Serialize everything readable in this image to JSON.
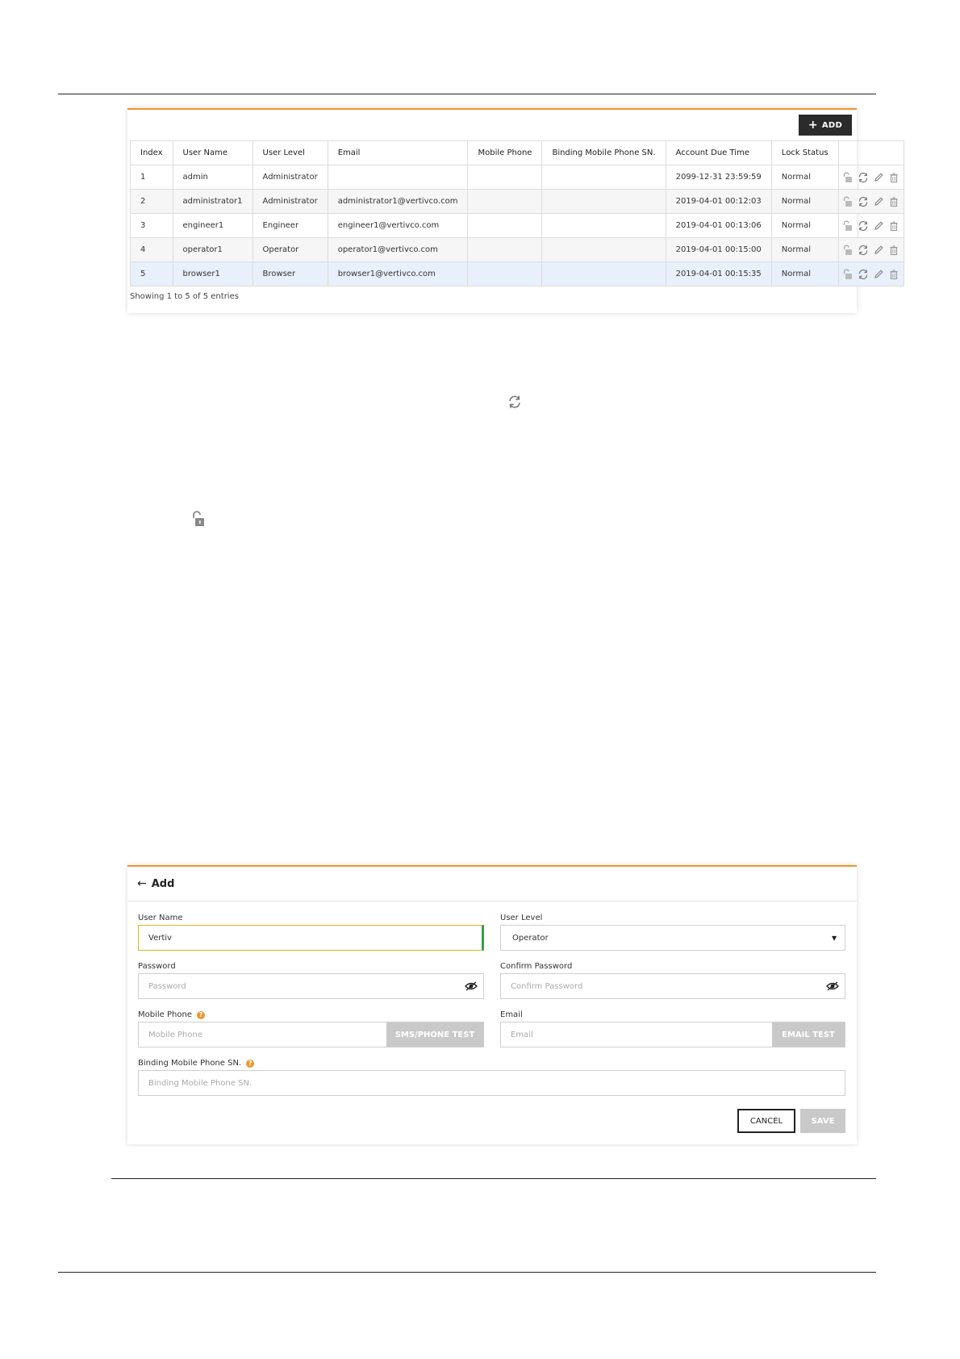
{
  "toolbar": {
    "add_label": "ADD"
  },
  "table": {
    "columns": [
      "Index",
      "User Name",
      "User Level",
      "Email",
      "Mobile Phone",
      "Binding Mobile Phone SN.",
      "Account Due Time",
      "Lock Status"
    ],
    "rows": [
      [
        "1",
        "admin",
        "Administrator",
        "",
        "",
        "",
        "2099-12-31 23:59:59",
        "Normal"
      ],
      [
        "2",
        "administrator1",
        "Administrator",
        "administrator1@vertivco.com",
        "",
        "",
        "2019-04-01 00:12:03",
        "Normal"
      ],
      [
        "3",
        "engineer1",
        "Engineer",
        "engineer1@vertivco.com",
        "",
        "",
        "2019-04-01 00:13:06",
        "Normal"
      ],
      [
        "4",
        "operator1",
        "Operator",
        "operator1@vertivco.com",
        "",
        "",
        "2019-04-01 00:15:00",
        "Normal"
      ],
      [
        "5",
        "browser1",
        "Browser",
        "browser1@vertivco.com",
        "",
        "",
        "2019-04-01 00:15:35",
        "Normal"
      ]
    ],
    "selected_row": 4,
    "row_actions": [
      "unlock-icon",
      "reset-icon",
      "edit-icon",
      "delete-icon"
    ],
    "footer": "Showing 1 to 5 of 5 entries"
  },
  "icons": {
    "reset": "reset-icon",
    "unlock": "unlock-icon"
  },
  "form": {
    "title": "Add",
    "user_name": {
      "label": "User Name",
      "value": "Vertiv"
    },
    "user_level": {
      "label": "User Level",
      "value": "Operator"
    },
    "password": {
      "label": "Password",
      "placeholder": "Password"
    },
    "confirm_password": {
      "label": "Confirm Password",
      "placeholder": "Confirm Password"
    },
    "mobile_phone": {
      "label": "Mobile Phone",
      "placeholder": "Mobile Phone",
      "test_label": "SMS/PHONE TEST"
    },
    "email": {
      "label": "Email",
      "placeholder": "Email",
      "test_label": "EMAIL TEST"
    },
    "binding_sn": {
      "label": "Binding Mobile Phone SN.",
      "placeholder": "Binding Mobile Phone SN."
    },
    "cancel_label": "CANCEL",
    "save_label": "SAVE"
  },
  "colors": {
    "accent": "#f0952e",
    "button_dark": "#2b2b2b",
    "button_disabled": "#c9c9c9",
    "selected_row": "#e8f0fb"
  }
}
